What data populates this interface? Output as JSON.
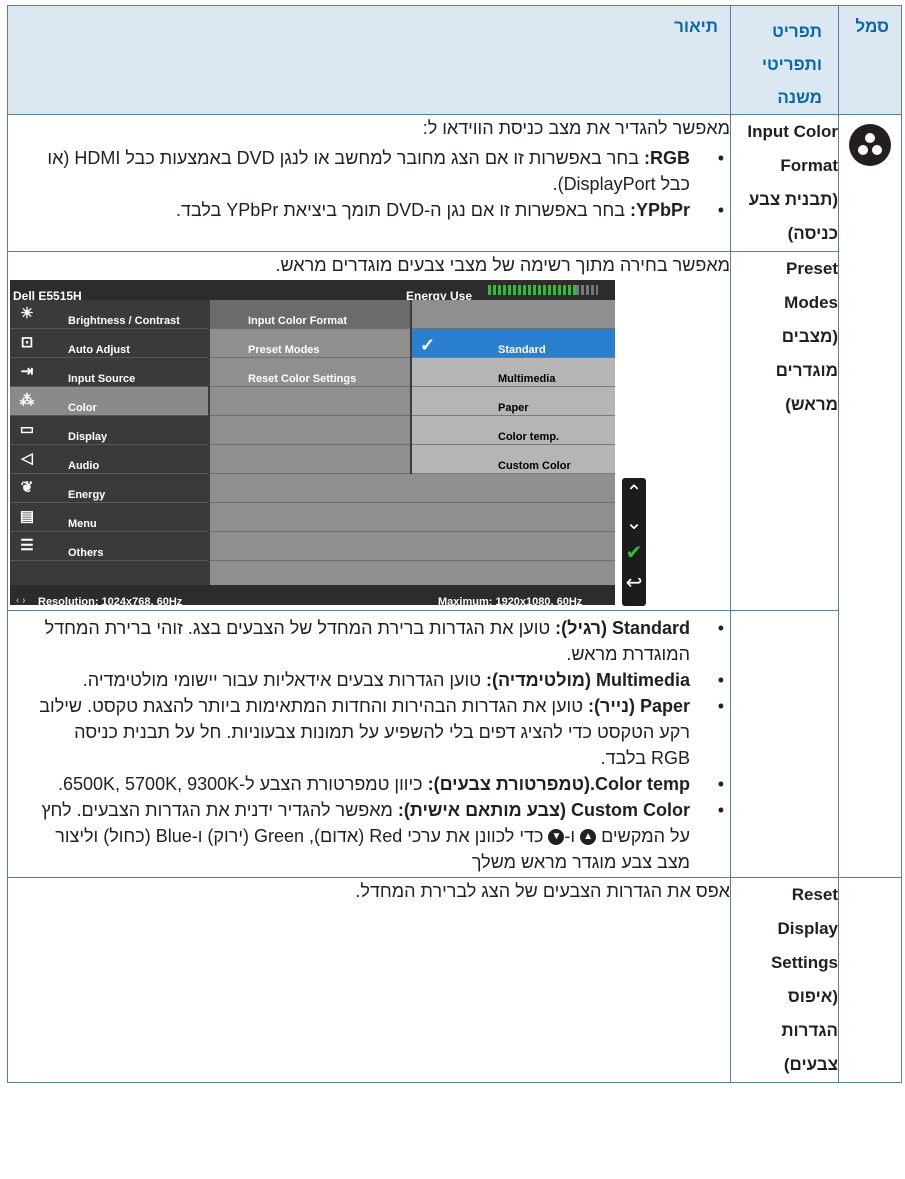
{
  "header": {
    "symbol": "סמל",
    "menu": "תפריט",
    "submenu": "ותפריטי משנה",
    "description": "תיאור"
  },
  "rows": {
    "input_color_format": {
      "menu_label": "Input Color Format",
      "menu_suffix": "(תבנית צבע כניסה)",
      "intro": "מאפשר להגדיר את מצב כניסת הווידאו ל:",
      "bullets": [
        {
          "term": "RGB:",
          "text": " בחר באפשרות זו אם הצג מחובר למחשב או לנגן DVD באמצעות כבל HDMI (או כבל DisplayPort)."
        },
        {
          "term": "YPbPr:",
          "text": " בחר באפשרות זו אם נגן ה-DVD תומך ביציאת YPbPr בלבד."
        }
      ],
      "icon": "color-icon"
    },
    "preset_modes": {
      "menu_label": "Preset Modes",
      "menu_suffix": "(מצבים מוגדרים מראש)",
      "intro": "מאפשר בחירה מתוך רשימה של מצבי צבעים מוגדרים מראש.",
      "bullets": [
        {
          "term": "Standard (רגיל):",
          "text": " טוען את הגדרות ברירת המחדל של הצבעים בצג. זוהי ברירת המחדל המוגדרת מראש."
        },
        {
          "term": "Multimedia (מולטימדיה):",
          "text": " טוען הגדרות צבעים אידאליות עבור יישומי מולטימדיה."
        },
        {
          "term": "Paper (נייר):",
          "text": " טוען את הגדרות הבהירות והחדות המתאימות ביותר להצגת טקסט. שילוב רקע הטקסט כדי להציג דפים בלי להשפיע על תמונות צבעוניות. חל על תבנית כניסה RGB בלבד."
        },
        {
          "term": "Color temp.(טמפרטורת צבעים):",
          "text": " כיוון טמפרטורת הצבע ל-6500K, 5700K, 9300K."
        },
        {
          "term": "Custom Color (צבע מותאם אישית):",
          "text_a": " מאפשר להגדיר ידנית את הגדרות הצבעים. לחץ על המקשים ",
          "text_b": " ו-",
          "text_c": " כדי לכוונן את ערכי Red (אדום), Green (ירוק) ו-Blue (כחול) וליצור מצב צבע מוגדר מראש משלך"
        }
      ]
    },
    "reset_display": {
      "menu_label": "Reset Display Settings",
      "menu_suffix": "(איפוס הגדרות צבעים)",
      "text": "אפס את הגדרות הצבעים של הצג לברירת המחדל."
    }
  },
  "osd": {
    "brand": "Dell E5515H",
    "energy_label": "Energy Use",
    "energy_level": 0.82,
    "menu": [
      {
        "label": "Brightness / Contrast",
        "icon": "sun-icon"
      },
      {
        "label": "Auto Adjust",
        "icon": "auto-adjust-icon"
      },
      {
        "label": "Input Source",
        "icon": "input-source-icon"
      },
      {
        "label": "Color",
        "icon": "color-dots-icon"
      },
      {
        "label": "Display",
        "icon": "display-icon"
      },
      {
        "label": "Audio",
        "icon": "speaker-icon"
      },
      {
        "label": "Energy",
        "icon": "leaf-icon"
      },
      {
        "label": "Menu",
        "icon": "menu-icon"
      },
      {
        "label": "Others",
        "icon": "sliders-icon"
      }
    ],
    "submenu": [
      "Input Color Format",
      "Preset Modes",
      "Reset Color Settings"
    ],
    "options": [
      "Standard",
      "Multimedia",
      "Paper",
      "Color temp.",
      "Custom Color"
    ],
    "resolution": "Resolution: 1024x768, 60Hz",
    "maximum": "Maximum: 1920x1080, 60Hz"
  }
}
